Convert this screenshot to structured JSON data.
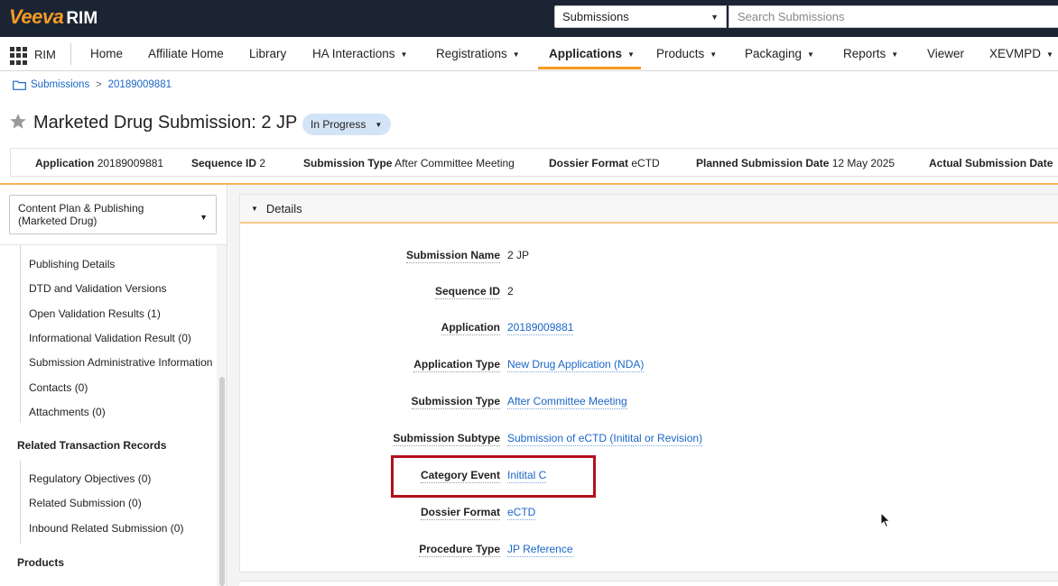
{
  "header": {
    "logo_main": "Veeva",
    "logo_sub": "RIM",
    "search_scope": "Submissions",
    "search_placeholder": "Search Submissions"
  },
  "nav": {
    "app_label": "RIM",
    "items": [
      {
        "label": "Home",
        "dropdown": false
      },
      {
        "label": "Affiliate Home",
        "dropdown": false
      },
      {
        "label": "Library",
        "dropdown": false
      },
      {
        "label": "HA Interactions",
        "dropdown": true
      },
      {
        "label": "Registrations",
        "dropdown": true
      },
      {
        "label": "Applications",
        "dropdown": true,
        "active": true
      },
      {
        "label": "Products",
        "dropdown": true
      },
      {
        "label": "Packaging",
        "dropdown": true
      },
      {
        "label": "Reports",
        "dropdown": true
      },
      {
        "label": "Viewer",
        "dropdown": false
      },
      {
        "label": "XEVMPD",
        "dropdown": true
      }
    ]
  },
  "breadcrumb": {
    "root": "Submissions",
    "current": "20189009881"
  },
  "title": {
    "text": "Marketed Drug Submission: 2 JP",
    "status": "In Progress"
  },
  "info_strip": [
    {
      "label": "Application",
      "value": "20189009881"
    },
    {
      "label": "Sequence ID",
      "value": "2"
    },
    {
      "label": "Submission Type",
      "value": "After Committee Meeting"
    },
    {
      "label": "Dossier Format",
      "value": "eCTD"
    },
    {
      "label": "Planned Submission Date",
      "value": "12 May 2025"
    },
    {
      "label": "Actual Submission Date",
      "value": ""
    }
  ],
  "left_panel": {
    "section_select": "Content Plan & Publishing (Marketed Drug)",
    "items_group1": [
      "Publishing Details",
      "DTD and Validation Versions",
      "Open Validation Results (1)",
      "Informational Validation Result (0)",
      "Submission Administrative Information",
      "Contacts (0)",
      "Attachments (0)"
    ],
    "header_related": "Related Transaction Records",
    "items_group2": [
      "Regulatory Objectives (0)",
      "Related Submission (0)",
      "Inbound Related Submission (0)"
    ],
    "header_products": "Products"
  },
  "details": {
    "section_title": "Details",
    "fields": [
      {
        "label": "Submission Name",
        "value": "2 JP",
        "link": false
      },
      {
        "label": "Sequence ID",
        "value": "2",
        "link": false
      },
      {
        "label": "Application",
        "value": "20189009881",
        "link": true
      },
      {
        "label": "Application Type",
        "value": "New Drug Application (NDA)",
        "link": true
      },
      {
        "label": "Submission Type",
        "value": "After Committee Meeting",
        "link": true
      },
      {
        "label": "Submission Subtype",
        "value": "Submission of eCTD (Initital or Revision)",
        "link": true
      },
      {
        "label": "Category Event",
        "value": "Initital C",
        "link": true
      },
      {
        "label": "Dossier Format",
        "value": "eCTD",
        "link": true
      },
      {
        "label": "Procedure Type",
        "value": "JP Reference",
        "link": true
      }
    ]
  },
  "colors": {
    "header_bg": "#1b2433",
    "brand_orange": "#f59a23",
    "link_blue": "#1a66c8",
    "highlight_red": "#b40f1d",
    "status_pill_bg": "#d4e4f7"
  }
}
